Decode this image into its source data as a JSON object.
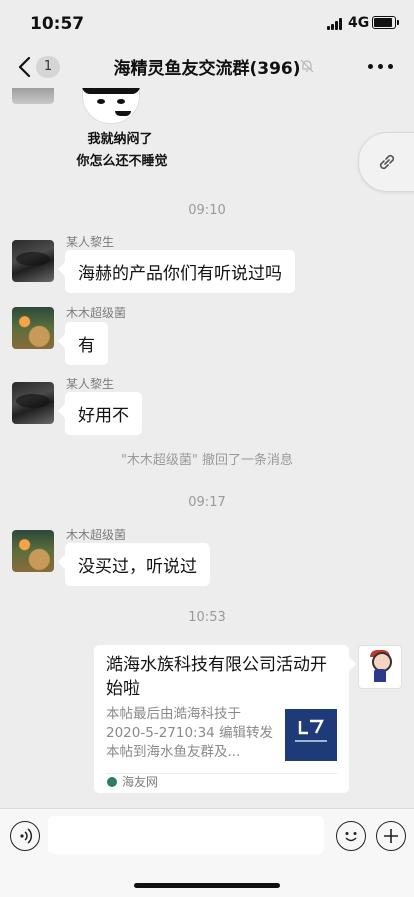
{
  "status": {
    "time": "10:57",
    "network": "4G"
  },
  "nav": {
    "badge": "1",
    "title": "海精灵鱼友交流群(396)"
  },
  "sticker": {
    "line1": "我就纳闷了",
    "line2": "你怎么还不睡觉"
  },
  "messages": [
    {
      "type": "time",
      "text": "09:10"
    },
    {
      "type": "msg",
      "sender": "某人黎生",
      "text": "海赫的产品你们有听说过吗"
    },
    {
      "type": "msg",
      "sender": "木木超级菌",
      "text": "有"
    },
    {
      "type": "msg",
      "sender": "某人黎生",
      "text": "好用不"
    },
    {
      "type": "recall",
      "text": "\"木木超级菌\" 撤回了一条消息"
    },
    {
      "type": "time",
      "text": "09:17"
    },
    {
      "type": "msg",
      "sender": "木木超级菌",
      "text": "没买过，听说过"
    },
    {
      "type": "time",
      "text": "10:53"
    }
  ],
  "card": {
    "title": "澔海水族科技有限公司活动开始啦",
    "desc": "本帖最后由澔海科技于 2020-5-2710:34 编辑转发本帖到海水鱼友群及...",
    "source": "海友网"
  },
  "icons": {
    "back": "chevron-left-icon",
    "mute": "mute-bell-icon",
    "more": "more-dots-icon",
    "link": "link-icon",
    "voice": "voice-icon",
    "emoji": "emoji-icon",
    "plus": "plus-icon"
  }
}
